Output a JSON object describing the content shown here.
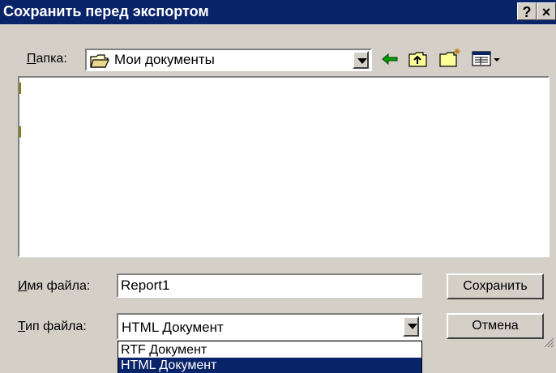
{
  "window": {
    "title": "Сохранить перед экспортом",
    "help_label": "?",
    "close_label": "×"
  },
  "folder": {
    "label_hotkey": "П",
    "label_rest": "апка:",
    "value": "Мои документы",
    "tools": [
      "back-arrow-icon",
      "up-folder-icon",
      "new-folder-icon",
      "view-menu-icon"
    ]
  },
  "filename": {
    "label_hotkey": "И",
    "label_rest": "мя файла:",
    "value": "Report1"
  },
  "filetype": {
    "label_hotkey": "Т",
    "label_rest": "ип файла:",
    "value": "HTML Документ",
    "options": [
      "RTF Документ",
      "HTML Документ"
    ]
  },
  "buttons": {
    "save": "Сохранить",
    "cancel": "Отмена"
  },
  "colors": {
    "title_bar": "#0a246a",
    "face": "#d4d0c8",
    "selection": "#0a246a"
  }
}
